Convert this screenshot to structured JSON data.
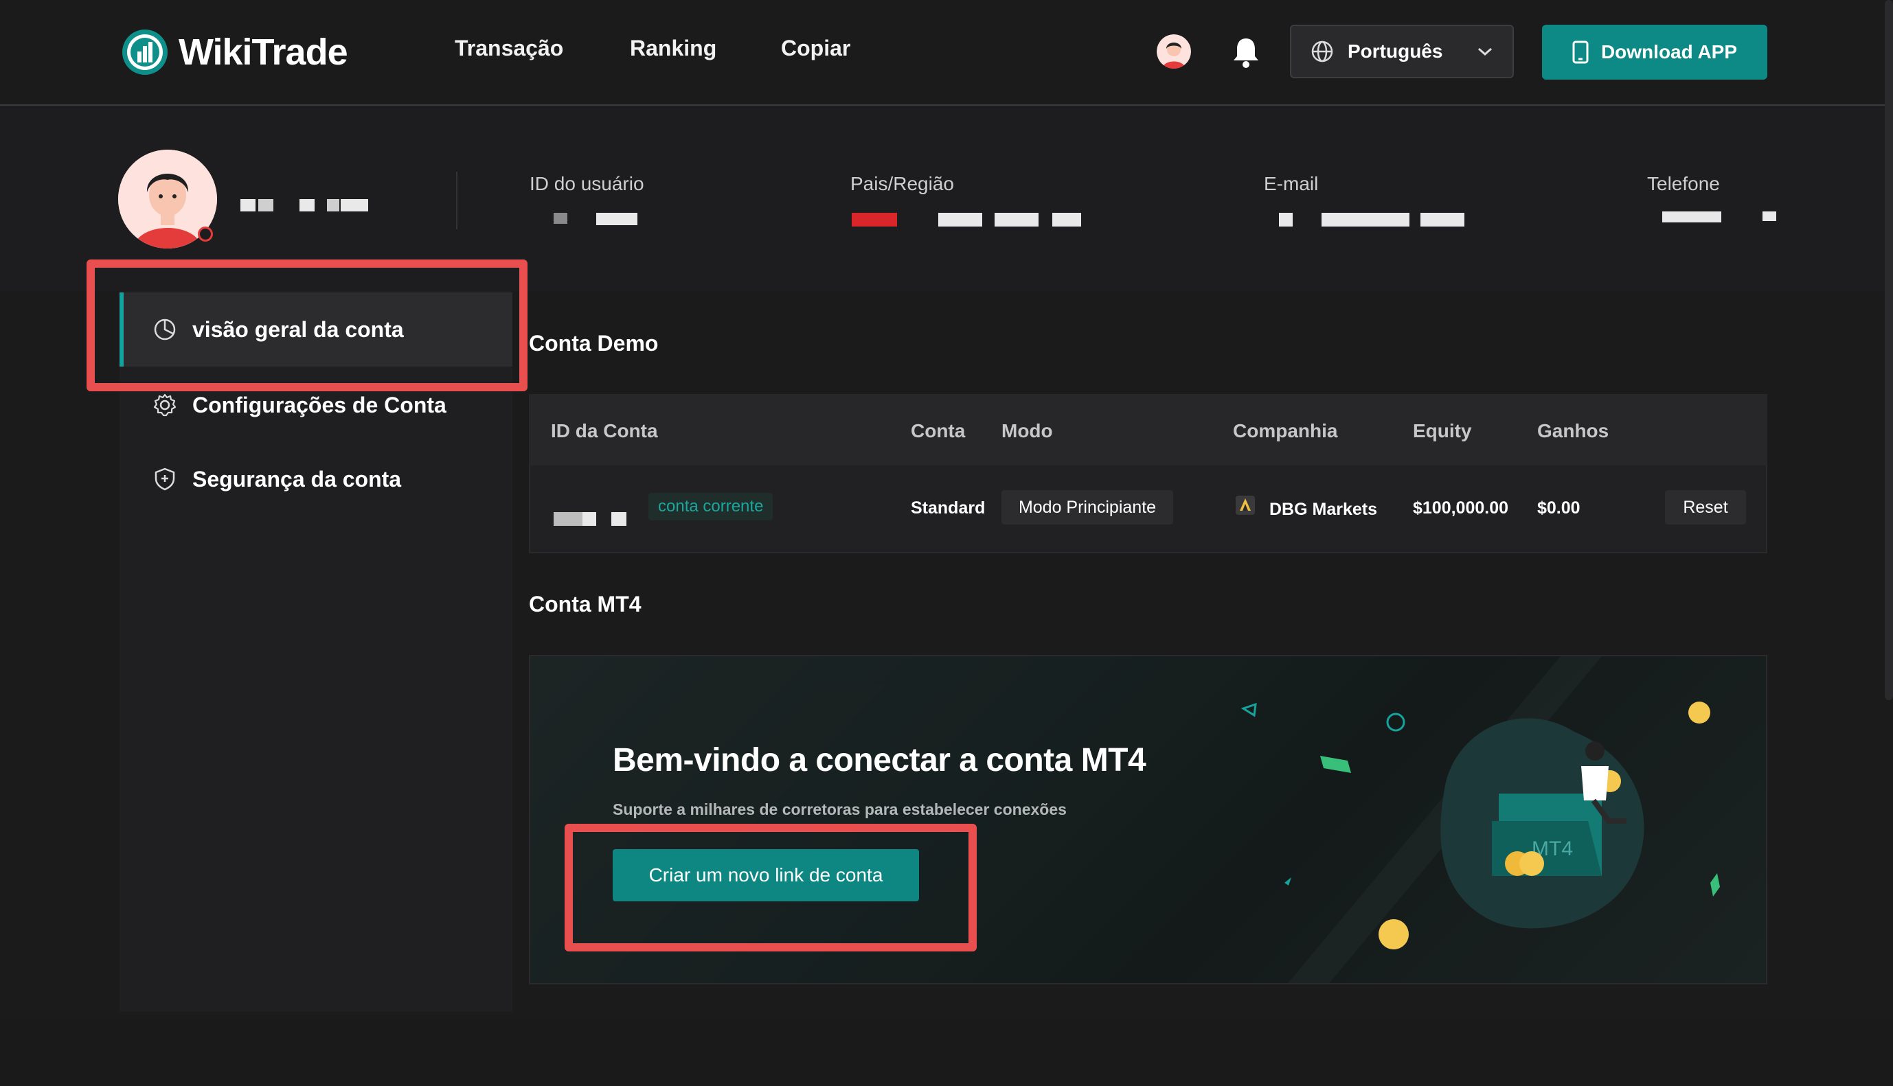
{
  "header": {
    "logo_text": "WikiTrade",
    "nav": [
      "Transação",
      "Ranking",
      "Copiar"
    ],
    "language": "Português",
    "download_label": "Download APP"
  },
  "user_info": {
    "labels": {
      "user_id": "ID do usuário",
      "country": "Pais/Região",
      "email": "E-mail",
      "phone": "Telefone"
    }
  },
  "sidebar": {
    "items": [
      {
        "label": "visão geral da conta",
        "icon": "pie-chart-icon",
        "active": true
      },
      {
        "label": "Configurações de Conta",
        "icon": "gear-icon",
        "active": false
      },
      {
        "label": "Segurança da conta",
        "icon": "shield-icon",
        "active": false
      }
    ]
  },
  "demo": {
    "title": "Conta Demo",
    "columns": [
      "ID da Conta",
      "Conta",
      "Modo",
      "Companhia",
      "Equity",
      "Ganhos"
    ],
    "row": {
      "tag": "conta corrente",
      "conta": "Standard",
      "modo": "Modo Principiante",
      "companhia": "DBG Markets",
      "equity": "$100,000.00",
      "ganhos": "$0.00",
      "action": "Reset"
    }
  },
  "mt4": {
    "section_title": "Conta MT4",
    "welcome_title": "Bem-vindo a conectar a conta MT4",
    "subtitle": "Suporte a milhares de corretoras para estabelecer conexões",
    "button_label": "Criar um novo link de conta",
    "illustration_text": "MT4"
  },
  "colors": {
    "accent": "#0d8a86",
    "highlight": "#ea4f4f",
    "background": "#1b1b1c"
  }
}
